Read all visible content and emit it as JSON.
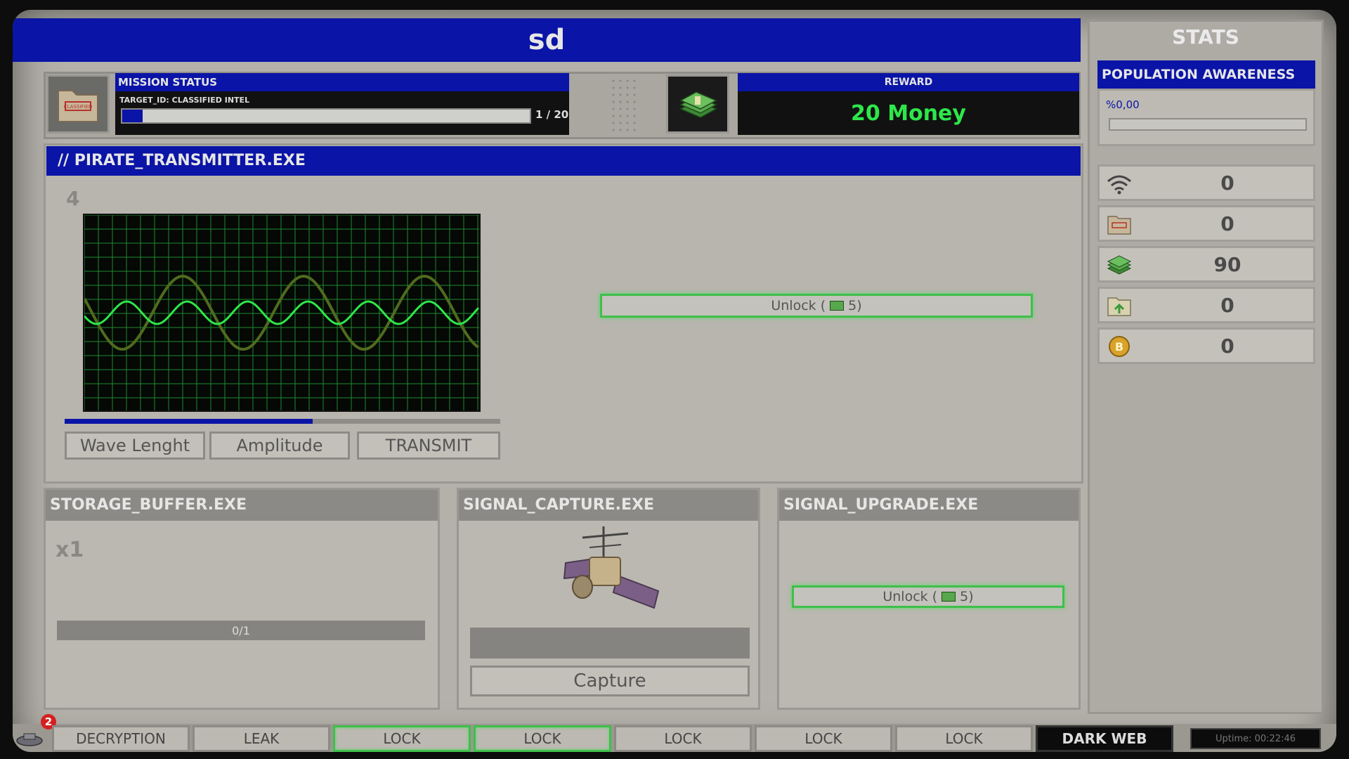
{
  "window": {
    "title": "sd"
  },
  "mission": {
    "header": "MISSION STATUS",
    "target": "TARGET_ID: CLASSIFIED INTEL",
    "progress_text": "1 / 20",
    "progress_fraction": 0.05
  },
  "reward": {
    "header": "REWARD",
    "value": "20 Money",
    "color": "#2ee64a"
  },
  "transmitter": {
    "title": "// PIRATE_TRANSMITTER.EXE",
    "counter": "4",
    "progress_fraction": 0.57,
    "buttons": {
      "wave": "Wave Lenght",
      "amplitude": "Amplitude",
      "transmit": "TRANSMIT"
    },
    "unlock_label": "Unlock (",
    "unlock_cost": "5)"
  },
  "storage": {
    "title": "STORAGE_BUFFER.EXE",
    "multiplier": "x1",
    "capacity": "0/1"
  },
  "capture": {
    "title": "SIGNAL_CAPTURE.EXE",
    "button": "Capture"
  },
  "upgrade": {
    "title": "SIGNAL_UPGRADE.EXE",
    "unlock_label": "Unlock (",
    "unlock_cost": "5)"
  },
  "stats": {
    "title": "STATS",
    "population_header": "POPULATION AWARENESS",
    "population_value": "%0,00",
    "rows": [
      {
        "icon": "wifi-icon",
        "value": "0"
      },
      {
        "icon": "classified-folder-icon",
        "value": "0"
      },
      {
        "icon": "money-icon",
        "value": "90"
      },
      {
        "icon": "folder-upload-icon",
        "value": "0"
      },
      {
        "icon": "bitcoin-icon",
        "value": "0"
      }
    ]
  },
  "taskbar": {
    "notification_count": "2",
    "tabs": [
      "DECRYPTION",
      "LEAK",
      "LOCK",
      "LOCK",
      "LOCK",
      "LOCK",
      "LOCK",
      "DARK WEB"
    ],
    "uptime": "Uptime: 00:22:46"
  },
  "colors": {
    "accent_blue": "#0a14a6",
    "unlock_green": "#3fbf4b",
    "wave_bright": "#2ee64a",
    "wave_dim": "#4f6b1e"
  }
}
